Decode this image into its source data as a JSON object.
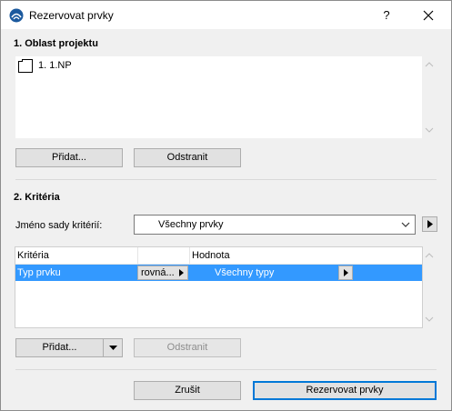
{
  "window": {
    "title": "Rezervovat prvky",
    "help_label": "?"
  },
  "project_area": {
    "heading": "1. Oblast projektu",
    "items": [
      {
        "label": "1. 1.NP",
        "icon": "story-icon"
      }
    ],
    "add_label": "Přidat...",
    "remove_label": "Odstranit"
  },
  "criteria": {
    "heading": "2. Kritéria",
    "set_name_label": "Jméno sady kritérií:",
    "set_name_value": "Všechny prvky",
    "columns": [
      "Kritéria",
      "Hodnota"
    ],
    "rows": [
      {
        "criterion": "Typ prvku",
        "operator": "rovná...",
        "value": "Všechny typy",
        "selected": true
      }
    ],
    "add_label": "Přidat...",
    "remove_label": "Odstranit"
  },
  "footer": {
    "cancel_label": "Zrušit",
    "confirm_label": "Rezervovat prvky"
  },
  "colors": {
    "selection": "#3399ff",
    "accent": "#0078d7"
  }
}
